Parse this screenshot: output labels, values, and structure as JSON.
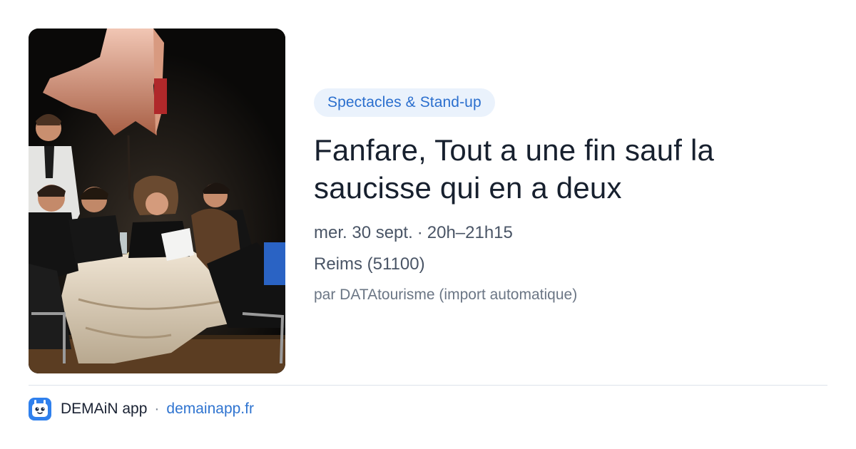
{
  "category": "Spectacles & Stand-up",
  "title": "Fanfare, Tout a une fin sauf la saucisse qui en a deux",
  "date": "mer. 30 sept.",
  "time": "20h–21h15",
  "date_time_separator": "·",
  "location": "Reims (51100)",
  "source": "par DATAtourisme (import automatique)",
  "footer": {
    "app_name": "DEMAiN app",
    "separator": "·",
    "link": "demainapp.fr",
    "icon": "app-logo-icon"
  },
  "photo": {
    "icon": "event-photo"
  },
  "colors": {
    "accent": "#2b6fce",
    "pill_background": "#eaf2fc",
    "title": "#17202e",
    "muted": "#6b7685",
    "app_icon": "#2f80ed"
  }
}
